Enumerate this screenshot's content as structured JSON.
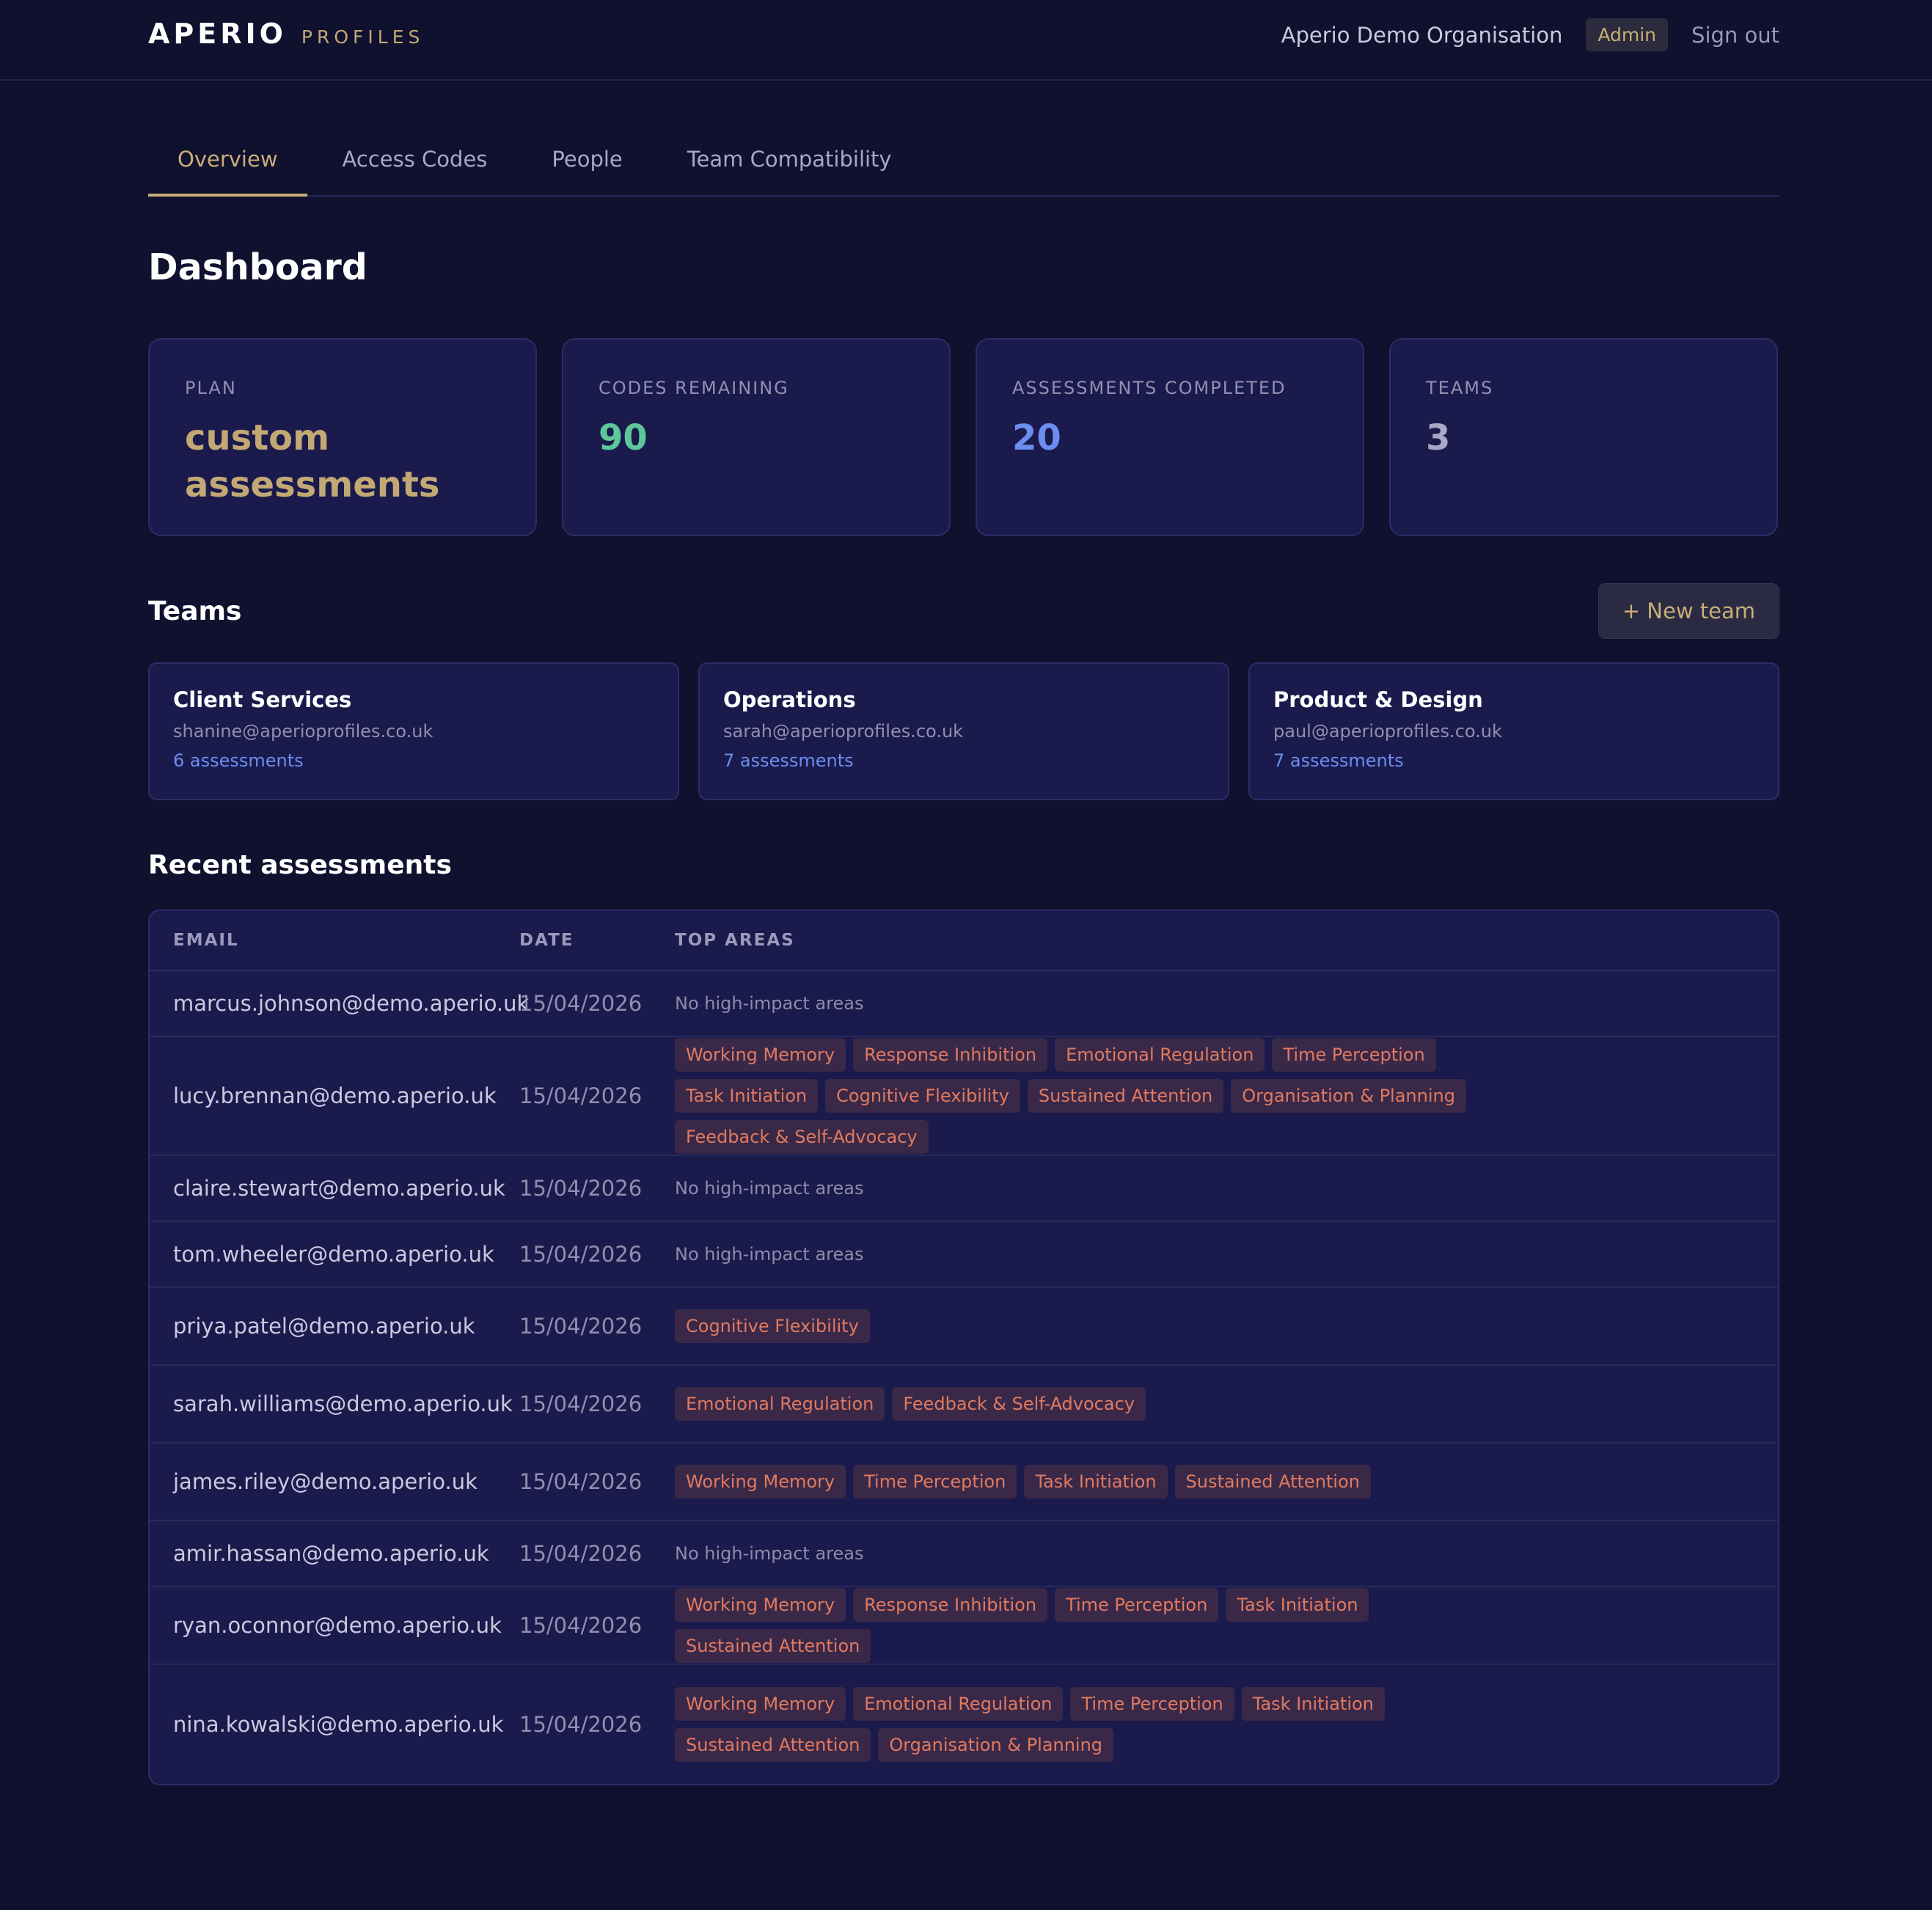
{
  "brand": {
    "main": "APERIO",
    "sub": "PROFILES"
  },
  "header": {
    "organisation": "Aperio Demo Organisation",
    "role": "Admin",
    "sign_out": "Sign out"
  },
  "tabs": [
    {
      "label": "Overview",
      "active": true
    },
    {
      "label": "Access Codes",
      "active": false
    },
    {
      "label": "People",
      "active": false
    },
    {
      "label": "Team Compatibility",
      "active": false
    }
  ],
  "page_title": "Dashboard",
  "stats": [
    {
      "label": "PLAN",
      "value": "custom assessments",
      "color": "#c2a874"
    },
    {
      "label": "CODES REMAINING",
      "value": "90",
      "color": "#5ec79a"
    },
    {
      "label": "ASSESSMENTS COMPLETED",
      "value": "20",
      "color": "#6b8ef0"
    },
    {
      "label": "TEAMS",
      "value": "3",
      "color": "#a6a8c6"
    }
  ],
  "teams_section": {
    "title": "Teams",
    "new_team_label": "+ New team"
  },
  "teams": [
    {
      "name": "Client Services",
      "email": "shanine@aperioprofiles.co.uk",
      "count": "6 assessments"
    },
    {
      "name": "Operations",
      "email": "sarah@aperioprofiles.co.uk",
      "count": "7 assessments"
    },
    {
      "name": "Product & Design",
      "email": "paul@aperioprofiles.co.uk",
      "count": "7 assessments"
    }
  ],
  "recent": {
    "title": "Recent assessments",
    "columns": [
      "EMAIL",
      "DATE",
      "TOP AREAS"
    ],
    "no_areas_text": "No high-impact areas",
    "rows": [
      {
        "email": "marcus.johnson@demo.aperio.uk",
        "date": "15/04/2026",
        "areas": []
      },
      {
        "email": "lucy.brennan@demo.aperio.uk",
        "date": "15/04/2026",
        "areas": [
          "Working Memory",
          "Response Inhibition",
          "Emotional Regulation",
          "Time Perception",
          "Task Initiation",
          "Cognitive Flexibility",
          "Sustained Attention",
          "Organisation & Planning",
          "Feedback & Self-Advocacy"
        ]
      },
      {
        "email": "claire.stewart@demo.aperio.uk",
        "date": "15/04/2026",
        "areas": []
      },
      {
        "email": "tom.wheeler@demo.aperio.uk",
        "date": "15/04/2026",
        "areas": []
      },
      {
        "email": "priya.patel@demo.aperio.uk",
        "date": "15/04/2026",
        "areas": [
          "Cognitive Flexibility"
        ]
      },
      {
        "email": "sarah.williams@demo.aperio.uk",
        "date": "15/04/2026",
        "areas": [
          "Emotional Regulation",
          "Feedback & Self-Advocacy"
        ]
      },
      {
        "email": "james.riley@demo.aperio.uk",
        "date": "15/04/2026",
        "areas": [
          "Working Memory",
          "Time Perception",
          "Task Initiation",
          "Sustained Attention"
        ]
      },
      {
        "email": "amir.hassan@demo.aperio.uk",
        "date": "15/04/2026",
        "areas": []
      },
      {
        "email": "ryan.oconnor@demo.aperio.uk",
        "date": "15/04/2026",
        "areas": [
          "Working Memory",
          "Response Inhibition",
          "Time Perception",
          "Task Initiation",
          "Sustained Attention"
        ]
      },
      {
        "email": "nina.kowalski@demo.aperio.uk",
        "date": "15/04/2026",
        "areas": [
          "Working Memory",
          "Emotional Regulation",
          "Time Perception",
          "Task Initiation",
          "Sustained Attention",
          "Organisation & Planning"
        ]
      }
    ]
  }
}
